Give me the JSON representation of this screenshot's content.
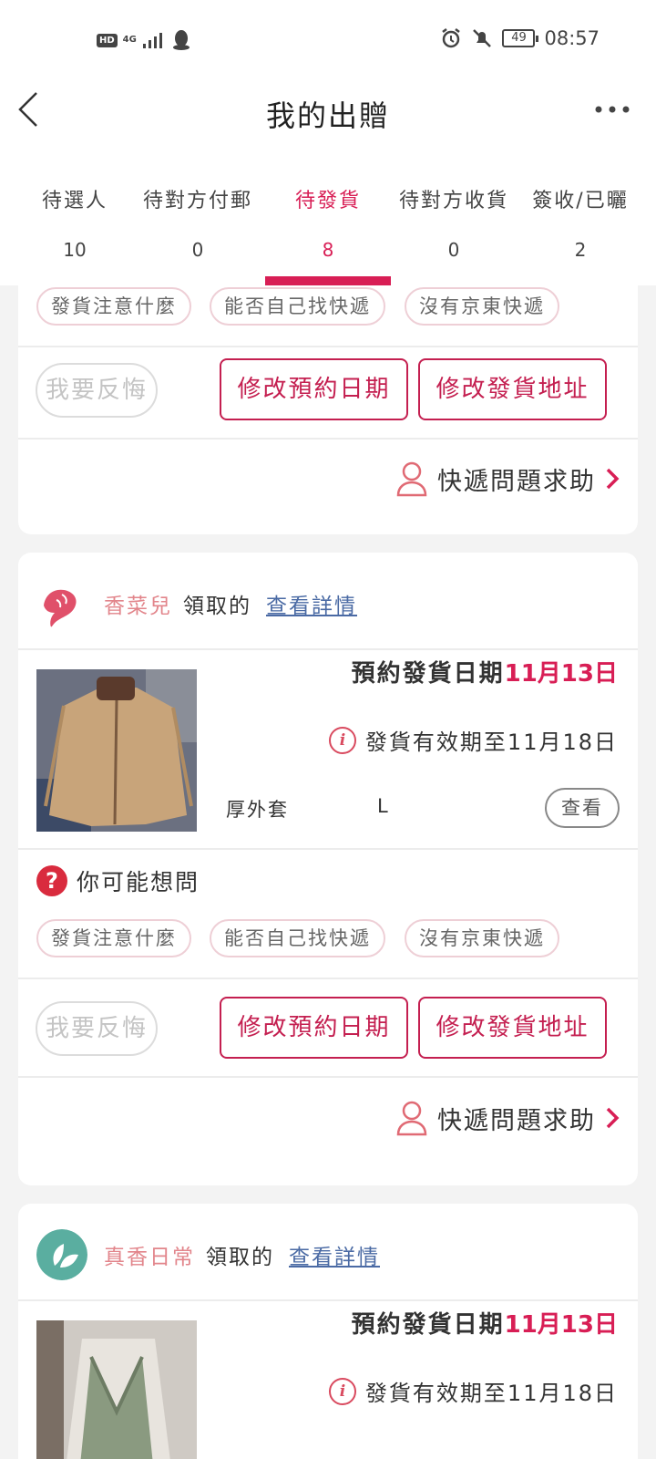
{
  "status_bar": {
    "hd": "HD",
    "network": "4G",
    "battery": "49",
    "time": "08:57",
    "icons": [
      "signal-icon",
      "qq-icon",
      "alarm-icon",
      "mute-icon",
      "battery-icon"
    ]
  },
  "header": {
    "title": "我的出贈",
    "back_icon": "chevron-left-icon",
    "more_icon": "more-icon"
  },
  "tabs": [
    {
      "label": "待選人",
      "count": "10"
    },
    {
      "label": "待對方付郵",
      "count": "0"
    },
    {
      "label": "待發貨",
      "count": "8",
      "active": true
    },
    {
      "label": "待對方收貨",
      "count": "0"
    },
    {
      "label": "簽收/已曬",
      "count": "2"
    }
  ],
  "colors": {
    "accent": "#d81e55",
    "button_border": "#c41f50",
    "username": "#e2858b",
    "link": "#4a6aa4"
  },
  "card0": {
    "chips": [
      "發貨注意什麼",
      "能否自己找快遞",
      "沒有京東快遞"
    ],
    "regret_label": "我要反悔",
    "change_date_label": "修改預約日期",
    "change_address_label": "修改發貨地址",
    "help_label": "快遞問題求助"
  },
  "card1": {
    "username": "香菜兒",
    "verb": "領取的",
    "detail_link": "查看詳情",
    "ship_date_label": "預約發貨日期",
    "ship_date": "11月13日",
    "valid_until": "發貨有效期至11月18日",
    "item_name": "厚外套",
    "item_size": "L",
    "view_label": "查看",
    "faq_title": "你可能想問",
    "chips": [
      "發貨注意什麼",
      "能否自己找快遞",
      "沒有京東快遞"
    ],
    "regret_label": "我要反悔",
    "change_date_label": "修改預約日期",
    "change_address_label": "修改發貨地址",
    "help_label": "快遞問題求助"
  },
  "card2": {
    "username": "真香日常",
    "verb": "領取的",
    "detail_link": "查看詳情",
    "ship_date_label": "預約發貨日期",
    "ship_date": "11月13日",
    "valid_until": "發貨有效期至11月18日"
  }
}
